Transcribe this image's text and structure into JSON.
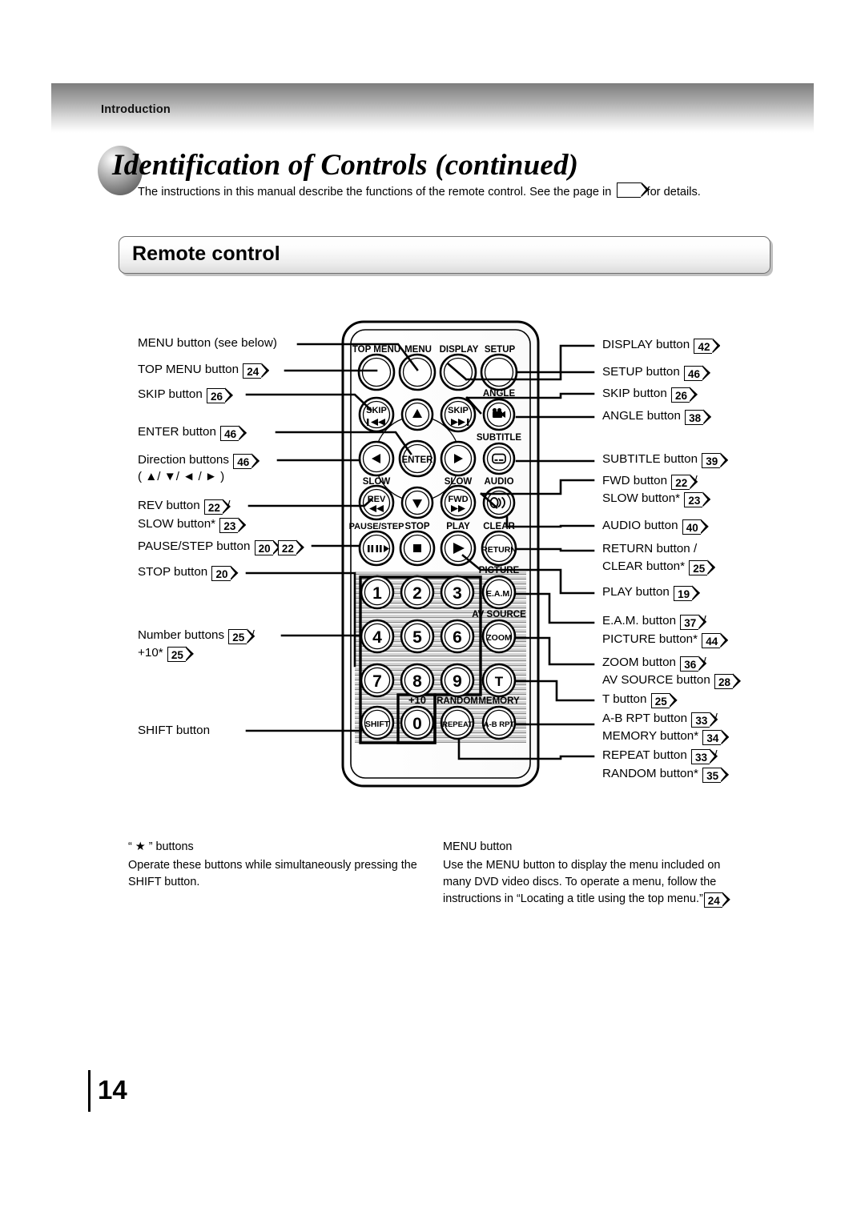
{
  "header": {
    "section_label": "Introduction"
  },
  "title": {
    "heading": "Identification of Controls (continued)",
    "intro_before": "The instructions in this manual describe the functions of the remote control. See the page in",
    "intro_after": "for details.",
    "intro_badge": ""
  },
  "section": {
    "title": "Remote control"
  },
  "remote": {
    "group_labels": {
      "top_menu": "TOP MENU",
      "menu": "MENU",
      "display": "DISPLAY",
      "setup": "SETUP",
      "angle": "ANGLE",
      "subtitle": "SUBTITLE",
      "audio": "AUDIO",
      "slow_left": "SLOW",
      "slow_right": "SLOW",
      "pause_step": "PAUSE/STEP",
      "stop": "STOP",
      "play": "PLAY",
      "clear": "CLEAR",
      "picture": "PICTURE",
      "av_source": "AV SOURCE",
      "plus_ten": "+10",
      "random": "RANDOM",
      "memory": "MEMORY"
    },
    "keys": {
      "skip_back": "SKIP",
      "skip_fwd": "SKIP",
      "enter": "ENTER",
      "rev": "REV",
      "fwd": "FWD",
      "return": "RETURN",
      "eam": "E.A.M.",
      "zoom": "ZOOM",
      "t": "T",
      "shift": "SHIFT",
      "repeat": "REPEAT",
      "ab_rpt": "A-B RPT",
      "numbers": [
        "1",
        "2",
        "3",
        "4",
        "5",
        "6",
        "7",
        "8",
        "9"
      ],
      "zero": "0"
    }
  },
  "callouts_left": [
    {
      "text": "MENU button (see below)",
      "pages": []
    },
    {
      "text": "TOP MENU button",
      "pages": [
        "24"
      ]
    },
    {
      "text": "SKIP button",
      "pages": [
        "26"
      ]
    },
    {
      "text": "ENTER button",
      "pages": [
        "46"
      ]
    },
    {
      "text": "Direction buttons",
      "pages": [
        "46"
      ],
      "sub": "( ▲/ ▼/ ◄ / ► )"
    },
    {
      "text": "REV button",
      "pages": [
        "22"
      ],
      "trailing": "/",
      "line2": "SLOW button*",
      "line2_pages": [
        "23"
      ]
    },
    {
      "text": "PAUSE/STEP button",
      "pages": [
        "20",
        "22"
      ]
    },
    {
      "text": "STOP button",
      "pages": [
        "20"
      ]
    },
    {
      "text": "Number buttons",
      "pages": [
        "25"
      ],
      "trailing": "/",
      "line2": "+10*",
      "line2_pages": [
        "25"
      ]
    },
    {
      "text": "SHIFT button",
      "pages": []
    }
  ],
  "callouts_right": [
    {
      "text": "DISPLAY button",
      "pages": [
        "42"
      ]
    },
    {
      "text": "SETUP button",
      "pages": [
        "46"
      ]
    },
    {
      "text": "SKIP button",
      "pages": [
        "26"
      ]
    },
    {
      "text": "ANGLE button",
      "pages": [
        "38"
      ]
    },
    {
      "text": "SUBTITLE button",
      "pages": [
        "39"
      ]
    },
    {
      "text": "FWD button",
      "pages": [
        "22"
      ],
      "trailing": "/",
      "line2": "SLOW button*",
      "line2_pages": [
        "23"
      ]
    },
    {
      "text": "AUDIO button",
      "pages": [
        "40"
      ]
    },
    {
      "text": "RETURN button /",
      "pages": [],
      "line2": "CLEAR button*",
      "line2_pages": [
        "25"
      ]
    },
    {
      "text": "PLAY button",
      "pages": [
        "19"
      ]
    },
    {
      "text": "E.A.M. button",
      "pages": [
        "37"
      ],
      "trailing": "/",
      "line2": "PICTURE button*",
      "line2_pages": [
        "44"
      ]
    },
    {
      "text": "ZOOM button",
      "pages": [
        "36"
      ],
      "trailing": "/",
      "line2": "AV SOURCE button",
      "line2_pages": [
        "28"
      ]
    },
    {
      "text": "T button",
      "pages": [
        "25"
      ]
    },
    {
      "text": "A-B RPT button",
      "pages": [
        "33"
      ],
      "trailing": "/",
      "line2": "MEMORY button*",
      "line2_pages": [
        "34"
      ]
    },
    {
      "text": "REPEAT button",
      "pages": [
        "33"
      ],
      "trailing": "/",
      "line2": "RANDOM button*",
      "line2_pages": [
        "35"
      ]
    }
  ],
  "footnotes": {
    "left_heading": "“ ★ ” buttons",
    "left_body": "Operate these buttons while simultaneously pressing the SHIFT button.",
    "right_heading": "MENU button",
    "right_body_1": "Use the MENU button to display the menu included on",
    "right_body_2": "many DVD video discs. To operate a menu, follow the",
    "right_body_3": "instructions in “Locating a title using the top menu.”",
    "right_body_badge": "24"
  },
  "page_number": "14"
}
